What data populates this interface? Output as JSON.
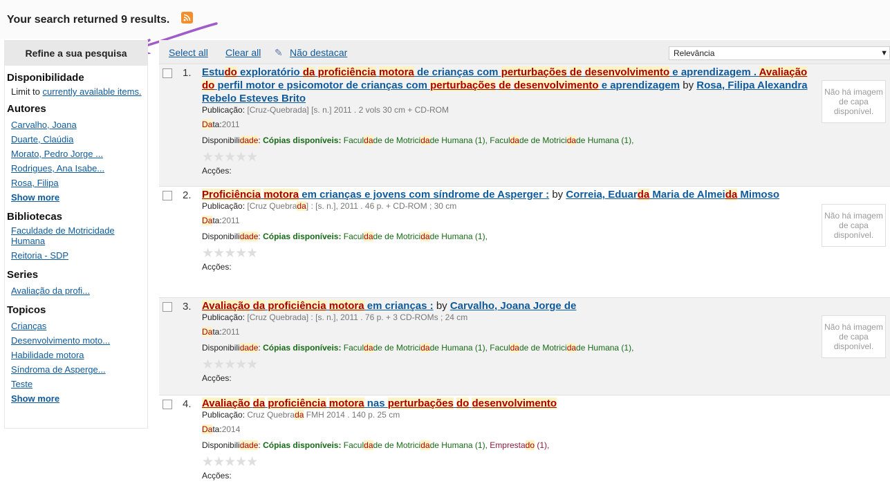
{
  "header": {
    "results_text": "Your search returned 9 results.",
    "rss_icon": "rss-feed-icon",
    "annotation_arrow": "purple-arrow-annotation"
  },
  "sidebar": {
    "title": "Refine a sua pesquisa",
    "availability": {
      "title": "Disponibilidade",
      "prefix": "Limit to ",
      "link": "currently available items."
    },
    "authors": {
      "title": "Autores",
      "items": [
        "Carvalho, Joana",
        "Duarte, Claúdia",
        "Morato, Pedro Jorge ...",
        "Rodrigues, Ana Isabe...",
        "Rosa, Filipa"
      ],
      "more": "Show more"
    },
    "libraries": {
      "title": "Bibliotecas",
      "items": [
        "Faculdade de Motricidade Humana",
        "Reitoria - SDP"
      ]
    },
    "series": {
      "title": "Series",
      "items": [
        "Avaliação da profi..."
      ]
    },
    "topics": {
      "title": "Topicos",
      "items": [
        "Crianças",
        "Desenvolvimento moto...",
        "Habilidade motora",
        "Síndroma de Asperge...",
        "Teste"
      ],
      "more": "Show more"
    }
  },
  "toolbar": {
    "select_all": "Select all",
    "clear_all": "Clear all",
    "unhighlight_icon": "pencil-icon",
    "unhighlight": "Não destacar",
    "sort_value": "Relevância",
    "sort_caret": "▼"
  },
  "labels": {
    "publication": "Publicação:",
    "date": "Data:",
    "availability_word": [
      "Disponibili",
      "dade",
      ":"
    ],
    "available_copies": "Cópias disponíveis:",
    "actions": "Acções:",
    "no_cover": "Não há imagem de capa disponível.",
    "by": "by",
    "stars": "★★★★★",
    "rating_icon": "star-rating-icon"
  },
  "results": [
    {
      "number": "1.",
      "title_parts": [
        {
          "t": "Estu",
          "h": false
        },
        {
          "t": "do",
          "h": true
        },
        {
          "t": " exploratório ",
          "h": false
        },
        {
          "t": "da",
          "h": true
        },
        {
          "t": " ",
          "h": false
        },
        {
          "t": "proficiência",
          "h": true
        },
        {
          "t": " ",
          "h": false
        },
        {
          "t": "motora",
          "h": true
        },
        {
          "t": " de crianças com ",
          "h": false
        },
        {
          "t": "perturbações",
          "h": true
        },
        {
          "t": " ",
          "h": false
        },
        {
          "t": "de",
          "h": true
        },
        {
          "t": " ",
          "h": false
        },
        {
          "t": "desenvolvimento",
          "h": true
        },
        {
          "t": " e aprendizagem . ",
          "h": false
        },
        {
          "t": "Avaliação",
          "h": true
        },
        {
          "t": " ",
          "h": false
        },
        {
          "t": "do",
          "h": true
        },
        {
          "t": " perfil motor e psicomotor de crianças com ",
          "h": false
        },
        {
          "t": "perturbações",
          "h": true
        },
        {
          "t": " ",
          "h": false
        },
        {
          "t": "de",
          "h": true
        },
        {
          "t": " ",
          "h": false
        },
        {
          "t": "desenvolvimento",
          "h": true
        },
        {
          "t": " e aprendizagem",
          "h": false
        }
      ],
      "author": "Rosa, Filipa Alexandra Rebelo Esteves Brito",
      "pub_parts": [
        {
          "t": "[Cruz-Quebrada] [s. n.] 2011 . 2 vols 30 cm + CD-ROM",
          "h": false
        }
      ],
      "date": "2011",
      "libraries": [
        [
          {
            "t": "Facul",
            "h": false
          },
          {
            "t": "da",
            "h": true
          },
          {
            "t": "de de Motrici",
            "h": false
          },
          {
            "t": "da",
            "h": true
          },
          {
            "t": "de Humana (1),",
            "h": false
          }
        ],
        [
          {
            "t": "Facul",
            "h": false
          },
          {
            "t": "da",
            "h": true
          },
          {
            "t": "de de Motrici",
            "h": false
          },
          {
            "t": "da",
            "h": true
          },
          {
            "t": "de Humana (1),",
            "h": false
          }
        ]
      ],
      "loan": []
    },
    {
      "number": "2.",
      "title_parts": [
        {
          "t": "Proficiência",
          "h": true
        },
        {
          "t": " ",
          "h": false
        },
        {
          "t": "motora",
          "h": true
        },
        {
          "t": " em crianças e jovens com síndrome de Asperger :",
          "h": false
        }
      ],
      "author_parts": [
        {
          "t": "Correia, Eduar",
          "h": false
        },
        {
          "t": "da",
          "h": true
        },
        {
          "t": " Maria de Almei",
          "h": false
        },
        {
          "t": "da",
          "h": true
        },
        {
          "t": " Mimoso",
          "h": false
        }
      ],
      "pub_parts": [
        {
          "t": "[Cruz Quebra",
          "h": false
        },
        {
          "t": "da",
          "h": true
        },
        {
          "t": "] : [s. n.], 2011 . 46 p. + CD-ROM ; 30 cm",
          "h": false
        }
      ],
      "date": "2011",
      "libraries": [
        [
          {
            "t": "Facul",
            "h": false
          },
          {
            "t": "da",
            "h": true
          },
          {
            "t": "de de Motrici",
            "h": false
          },
          {
            "t": "da",
            "h": true
          },
          {
            "t": "de Humana (1),",
            "h": false
          }
        ]
      ],
      "loan": []
    },
    {
      "number": "3.",
      "title_parts": [
        {
          "t": "Avaliação",
          "h": true
        },
        {
          "t": " ",
          "h": false
        },
        {
          "t": "da",
          "h": true
        },
        {
          "t": " ",
          "h": false
        },
        {
          "t": "proficiência",
          "h": true
        },
        {
          "t": " ",
          "h": false
        },
        {
          "t": "motora",
          "h": true
        },
        {
          "t": " em crianças :",
          "h": false
        }
      ],
      "author": "Carvalho, Joana Jorge de",
      "pub_parts": [
        {
          "t": "[Cruz Quebrada] : [s. n.], 2011 . 76 p. + 3 CD-ROMs ; 24 cm",
          "h": false
        }
      ],
      "date": "2011",
      "libraries": [
        [
          {
            "t": "Facul",
            "h": false
          },
          {
            "t": "da",
            "h": true
          },
          {
            "t": "de de Motrici",
            "h": false
          },
          {
            "t": "da",
            "h": true
          },
          {
            "t": "de Humana (1),",
            "h": false
          }
        ],
        [
          {
            "t": "Facul",
            "h": false
          },
          {
            "t": "da",
            "h": true
          },
          {
            "t": "de de Motrici",
            "h": false
          },
          {
            "t": "da",
            "h": true
          },
          {
            "t": "de Humana (1),",
            "h": false
          }
        ]
      ],
      "loan": []
    },
    {
      "number": "4.",
      "title_parts": [
        {
          "t": "Avaliação",
          "h": true
        },
        {
          "t": " ",
          "h": false
        },
        {
          "t": "da",
          "h": true
        },
        {
          "t": " ",
          "h": false
        },
        {
          "t": "proficiência",
          "h": true
        },
        {
          "t": " ",
          "h": false
        },
        {
          "t": "motora",
          "h": true
        },
        {
          "t": " nas ",
          "h": false
        },
        {
          "t": "perturbações",
          "h": true
        },
        {
          "t": " ",
          "h": false
        },
        {
          "t": "do",
          "h": true
        },
        {
          "t": " ",
          "h": false
        },
        {
          "t": "desenvolvimento",
          "h": true
        }
      ],
      "pub_parts": [
        {
          "t": "Cruz Quebra",
          "h": false
        },
        {
          "t": "da",
          "h": true
        },
        {
          "t": " FMH 2014 . 140 p. 25 cm",
          "h": false
        }
      ],
      "date": "2014",
      "libraries": [
        [
          {
            "t": "Facul",
            "h": false
          },
          {
            "t": "da",
            "h": true
          },
          {
            "t": "de de Motrici",
            "h": false
          },
          {
            "t": "da",
            "h": true
          },
          {
            "t": "de Humana (1),",
            "h": false
          }
        ]
      ],
      "loan": [
        {
          "t": "Empresta",
          "h": false
        },
        {
          "t": "do",
          "h": true
        },
        {
          "t": " (1),",
          "h": false
        }
      ]
    }
  ]
}
